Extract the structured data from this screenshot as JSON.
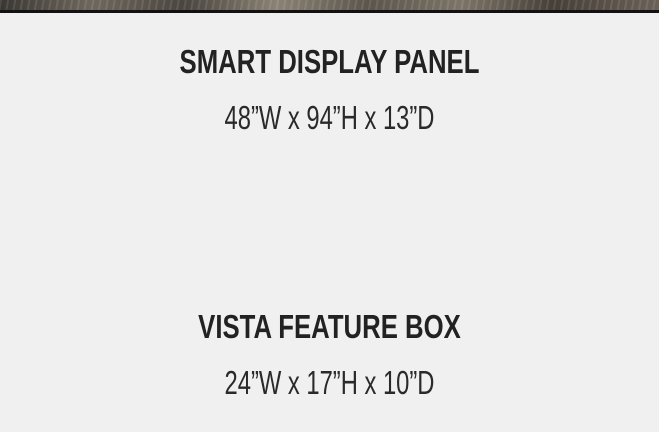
{
  "products": [
    {
      "name": "SMART DISPLAY PANEL",
      "dimensions": "48”W x 94”H x 13”D"
    },
    {
      "name": "VISTA FEATURE BOX",
      "dimensions": "24”W x 17”H x 10”D"
    }
  ],
  "colors": {
    "background": "#f0f0f0",
    "text": "#222222"
  }
}
